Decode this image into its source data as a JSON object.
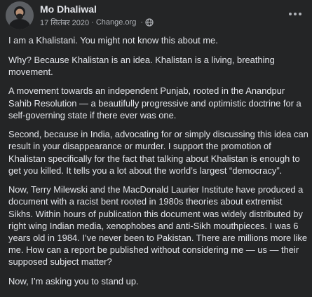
{
  "post": {
    "author": "Mo Dhaliwal",
    "date": "17 सितंबर 2020",
    "separator_dot": "·",
    "source": "Change.org",
    "separator_dot_2": "·",
    "audience_icon": "globe-icon",
    "more_icon": "more-options-icon",
    "paragraphs": [
      "I am a Khalistani. You might not know this about me.",
      "Why? Because Khalistan is an idea. Khalistan is a living, breathing movement.",
      "A movement towards an independent Punjab, rooted in the Anandpur Sahib Resolution — a beautifully progressive and optimistic doctrine for a self-governing state if there ever was one.",
      "Second, because in India, advocating for or simply discussing this idea can result in your disappearance or murder. I support the promotion of Khalistan specifically for the fact that talking about Khalistan is enough to get you killed. It tells you a lot about the world’s largest “democracy”.",
      "Now, Terry Milewski and the MacDonald Laurier Institute have produced a document with a racist bent rooted in 1980s theories about extremist Sikhs. Within hours of publication this document was widely distributed by right wing Indian media, xenophobes and anti-Sikh mouthpieces. I was 6 years old in 1984. I’ve never been to Pakistan. There are millions more like me. How can a report be published without considering me — us — their supposed subject matter?",
      "Now, I’m asking you to stand up."
    ]
  },
  "colors": {
    "background": "#242526",
    "primary_text": "#e4e6eb",
    "secondary_text": "#b0b3b8"
  }
}
